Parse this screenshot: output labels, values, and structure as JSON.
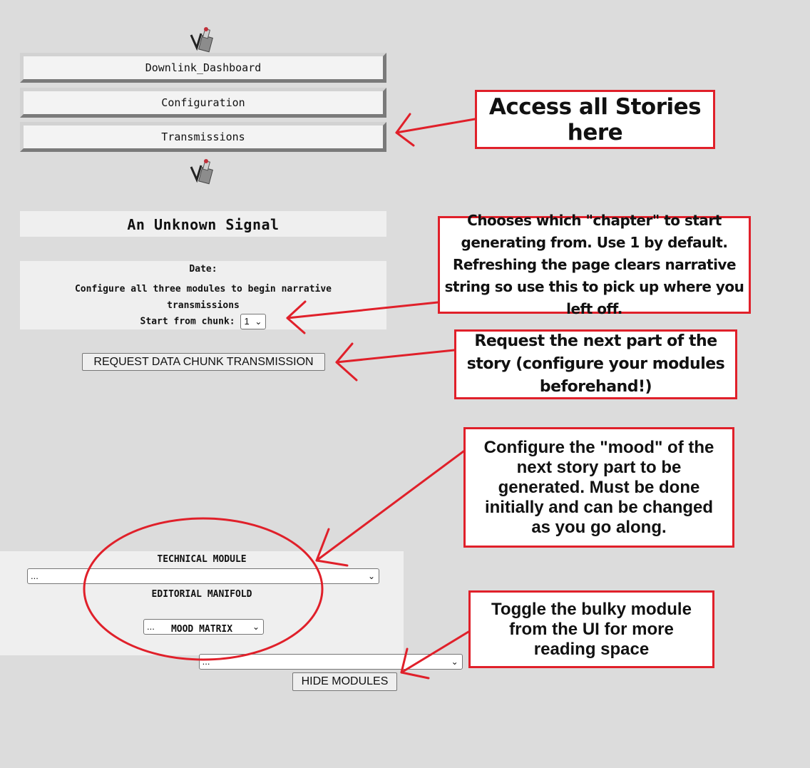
{
  "nav": {
    "logo_icon": "robot-logo-icon",
    "items": [
      "Downlink_Dashboard",
      "Configuration",
      "Transmissions"
    ]
  },
  "story": {
    "title": "An Unknown Signal",
    "date_label": "Date:",
    "message": "Configure all three modules to begin narrative transmissions",
    "chunk_label": "Start from chunk:",
    "chunk_value": "1",
    "request_button": "REQUEST DATA CHUNK TRANSMISSION"
  },
  "modules": {
    "technical_label": "TECHNICAL MODULE",
    "technical_value": "...",
    "editorial_label": "EDITORIAL MANIFOLD",
    "editorial_value": "...",
    "mood_label": "MOOD MATRIX",
    "mood_value": "...",
    "hide_button": "HIDE MODULES"
  },
  "annotations": {
    "access_stories": "Access all Stories here",
    "chunk_help": "Chooses which \"chapter\" to start generating from. Use 1 by default. Refreshing the page clears narrative string so use this to pick up where you left off.",
    "request_help": "Request the next part of the story (configure your modules beforehand!)",
    "mood_help": "Configure the \"mood\" of the next story part to be generated. Must be done initially and can be changed as you go along.",
    "toggle_help": "Toggle the bulky module from the UI for more reading space"
  },
  "colors": {
    "annotation_red": "#e0202a",
    "background": "#dcdcdc",
    "panel": "#efefef"
  }
}
